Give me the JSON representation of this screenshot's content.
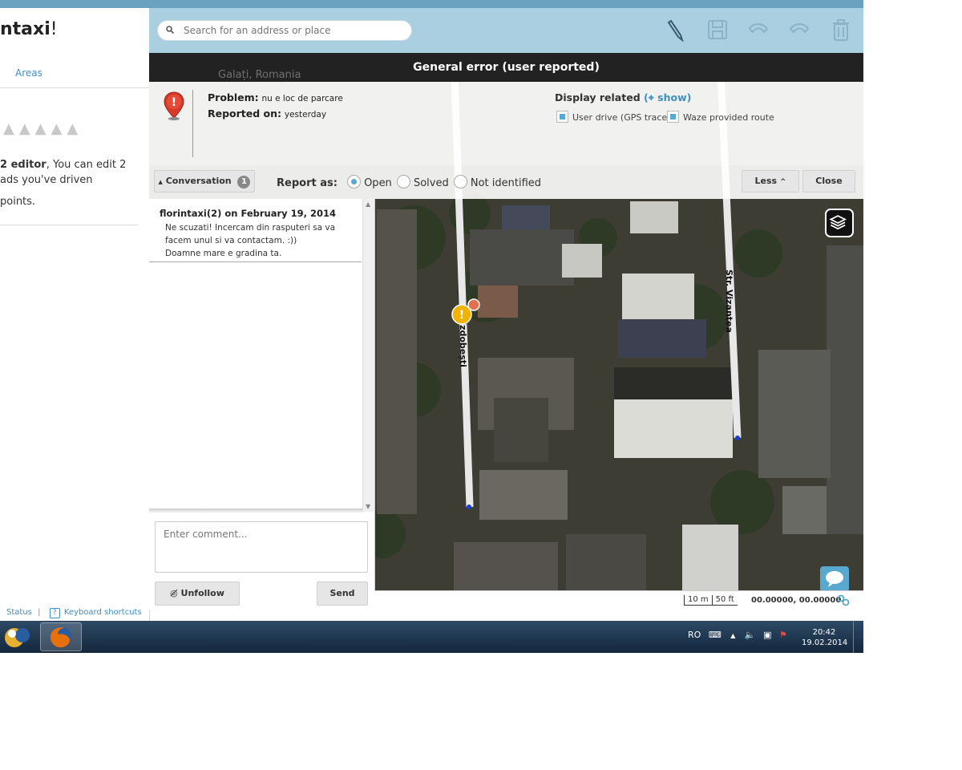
{
  "sidebar": {
    "welcome_name": "ntaxi",
    "welcome_suffix": "!",
    "tab_areas": "Areas",
    "rank_cones": "▲▲▲▲▲",
    "editor_bold": "2 editor",
    "editor_rest": ", You can edit 2",
    "editor_line2": "ads you've driven",
    "points_text": "points.",
    "footer_status": "Status",
    "footer_separator": "|",
    "footer_help_icon": "?",
    "footer_shortcuts": "Keyboard shortcuts"
  },
  "toolbar": {
    "search_placeholder": "Search for an address or place",
    "icons": [
      "pencil-icon",
      "save-icon",
      "undo-icon",
      "redo-icon",
      "trash-icon"
    ]
  },
  "map": {
    "city_label": "Galați, Romania",
    "streets": [
      "Str. Vizantea",
      "Izdobești"
    ],
    "scale_m": "10 m",
    "scale_ft": "50 ft",
    "coordinates": "00.00000, 00.00000"
  },
  "issue": {
    "title": "General error (user reported)",
    "problem_label": "Problem:",
    "problem_value": "nu e loc de parcare",
    "reported_label": "Reported on:",
    "reported_value": "yesterday",
    "display_related": "Display related",
    "show_link": "show",
    "checkbox_gps": "User drive (GPS trace)",
    "checkbox_route": "Waze provided route"
  },
  "conversation_bar": {
    "conversation_label": "Conversation",
    "conversation_count": "1",
    "report_as": "Report as:",
    "opt_open": "Open",
    "opt_solved": "Solved",
    "opt_not_identified": "Not identified",
    "selected": "Open",
    "less_label": "Less",
    "close_label": "Close"
  },
  "conversation": {
    "messages": [
      {
        "author": "florintaxi(2) on February 19, 2014",
        "lines": [
          "Ne scuzati! Incercam din rasputeri sa va",
          "facem unul si va contactam. :))",
          "Doamne mare e gradina ta."
        ]
      }
    ],
    "comment_placeholder": "Enter comment...",
    "unfollow_label": "Unfollow",
    "send_label": "Send"
  },
  "taskbar": {
    "lang": "RO",
    "time": "20:42",
    "date": "19.02.2014"
  },
  "colors": {
    "toolbar_bg": "#a9cfe0",
    "accent": "#58a8d0",
    "link": "#3d8fc0",
    "issue_header": "#222222",
    "taskbar": "#1e3550"
  }
}
